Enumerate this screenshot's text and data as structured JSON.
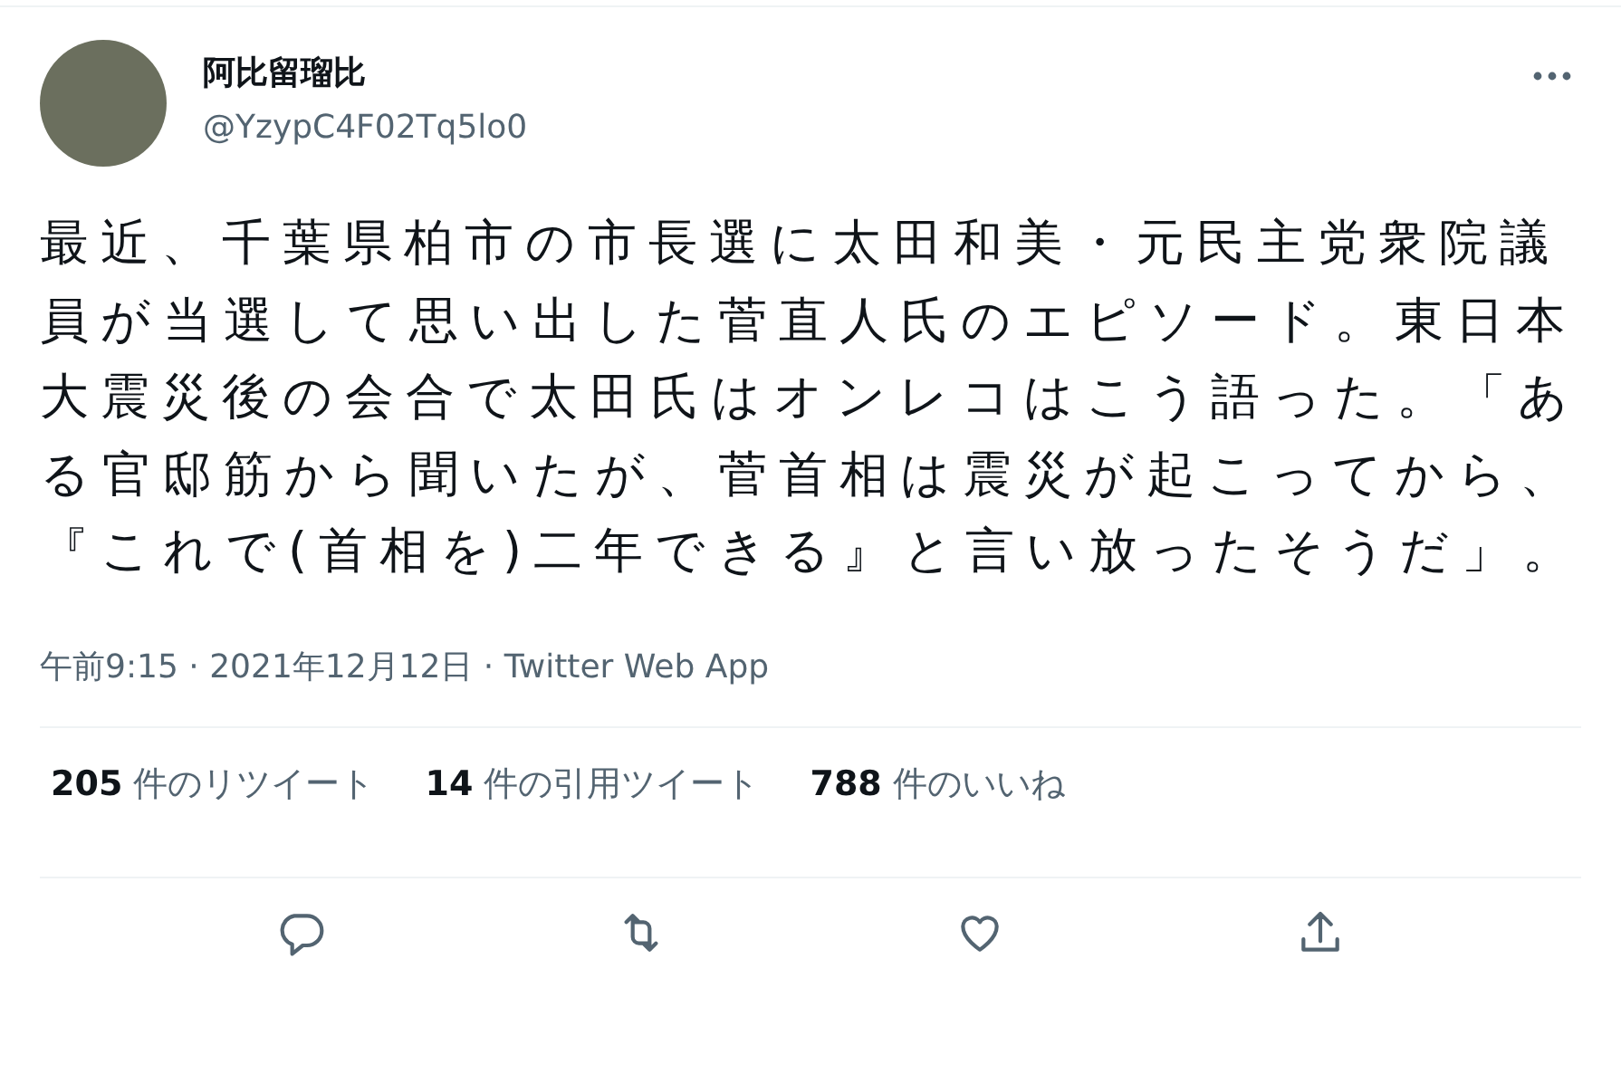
{
  "author": {
    "name": "阿比留瑠比",
    "handle": "@YzypC4F02Tq5lo0"
  },
  "body": "最近、千葉県柏市の市長選に太田和美・元民主党衆院議員が当選して思い出した菅直人氏のエピソード。東日本大震災後の会合で太田氏はオンレコはこう語った。「ある官邸筋から聞いたが、菅首相は震災が起こってから、『これで(首相を)二年できる』と言い放ったそうだ」。",
  "meta": "午前9:15 · 2021年12月12日 · Twitter Web App",
  "stats": [
    {
      "count": "205",
      "label": "件のリツイート"
    },
    {
      "count": "14",
      "label": "件の引用ツイート"
    },
    {
      "count": "788",
      "label": "件のいいね"
    }
  ],
  "actions": [
    {
      "kind": "reply"
    },
    {
      "kind": "retweet"
    },
    {
      "kind": "like"
    },
    {
      "kind": "share"
    }
  ]
}
